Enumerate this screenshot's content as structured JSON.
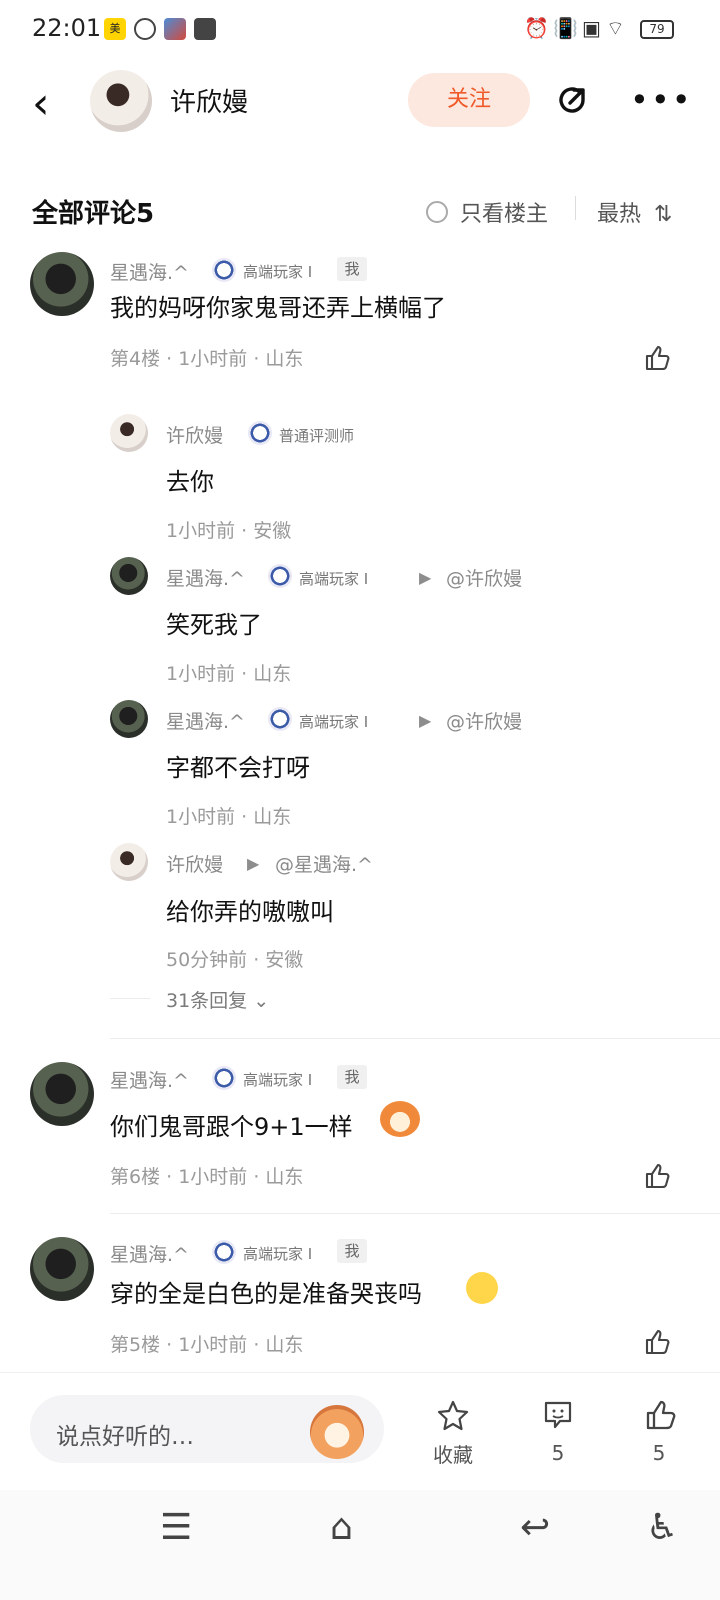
{
  "status_bar": {
    "time": "22:01",
    "battery": "79",
    "icons_left": [
      "app-badge-icon",
      "swirl-icon",
      "game-icon",
      "message-icon"
    ],
    "icons_right": [
      "alarm-icon",
      "vibrate-icon",
      "no-sim-icon",
      "wifi-icon",
      "battery-icon"
    ]
  },
  "header": {
    "title": "许欣嫚",
    "follow_label": "关注"
  },
  "comments_header": {
    "title": "全部评论5",
    "owner_only_label": "只看楼主",
    "sort_label": "最热",
    "sort_icon": "sort-icon"
  },
  "comments": [
    {
      "author": "星遇海.^",
      "level": "高端玩家",
      "level_suffix": "I",
      "tag": "我",
      "text": "我的妈呀你家鬼哥还弄上横幅了",
      "meta": "第4楼 · 1小时前 · 山东",
      "replies": [
        {
          "author": "许欣嫚",
          "level": "普通评测师",
          "text": "去你",
          "meta": "1小时前 · 安徽"
        },
        {
          "author": "星遇海.^",
          "level": "高端玩家",
          "level_suffix": "I",
          "reply_to": "@许欣嫚",
          "text": "笑死我了",
          "meta": "1小时前 · 山东"
        },
        {
          "author": "星遇海.^",
          "level": "高端玩家",
          "level_suffix": "I",
          "reply_to": "@许欣嫚",
          "text": "字都不会打呀",
          "meta": "1小时前 · 山东"
        },
        {
          "author": "许欣嫚",
          "reply_to": "@星遇海.^",
          "text": "给你弄的嗷嗷叫",
          "meta": "50分钟前 · 安徽"
        }
      ],
      "more_replies": "31条回复"
    },
    {
      "author": "星遇海.^",
      "level": "高端玩家",
      "level_suffix": "I",
      "tag": "我",
      "text": "你们鬼哥跟个9+1一样",
      "meta": "第6楼 · 1小时前 · 山东"
    },
    {
      "author": "星遇海.^",
      "level": "高端玩家",
      "level_suffix": "I",
      "tag": "我",
      "text": "穿的全是白色的是准备哭丧吗",
      "meta": "第5楼 · 1小时前 · 山东"
    }
  ],
  "bottom_bar": {
    "input_placeholder": "说点好听的…",
    "collect_label": "收藏",
    "comment_count": "5",
    "like_count": "5"
  },
  "nav_bar": {
    "icons": [
      "menu-icon",
      "home-icon",
      "back-icon",
      "accessibility-icon"
    ]
  },
  "colors": {
    "accent": "#f05a2a",
    "follow_bg": "#fde8df",
    "meta_text": "#9a9a9a"
  }
}
